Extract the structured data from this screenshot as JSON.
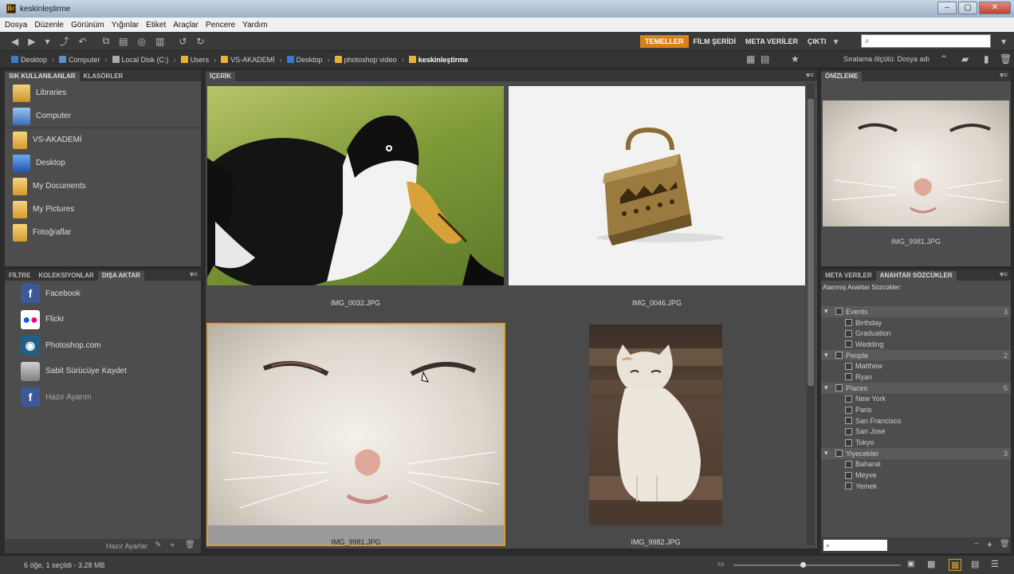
{
  "window": {
    "title": "keskinleştirme",
    "app_icon": "Br"
  },
  "menu": [
    "Dosya",
    "Düzenle",
    "Görünüm",
    "Yığınlar",
    "Etiket",
    "Araçlar",
    "Pencere",
    "Yardım"
  ],
  "workspaces": {
    "items": [
      "TEMELLER",
      "FİLM ŞERİDİ",
      "META VERİLER",
      "ÇIKTI"
    ],
    "active": 0,
    "accent": "#d8801a"
  },
  "search": {
    "placeholder": ""
  },
  "breadcrumb": [
    "Desktop",
    "Computer",
    "Local Disk (C:)",
    "Users",
    "VS-AKADEMİ",
    "Desktop",
    "photoshop video",
    "keskinleştirme"
  ],
  "sort_label": "Sıralama ölçütü: Dosya adı",
  "favorites": {
    "tabs": [
      "SIK KULLANILANLAR",
      "KLASÖRLER"
    ],
    "items": [
      {
        "label": "Libraries",
        "icon": "libraries-icon",
        "color": "#e6b84a"
      },
      {
        "label": "Computer",
        "icon": "computer-icon",
        "color": "#5a8fd0"
      },
      {
        "label": "VS-AKADEMİ",
        "icon": "folder-icon",
        "color": "#e8b23a"
      },
      {
        "label": "Desktop",
        "icon": "desktop-icon",
        "color": "#3a7ad0"
      },
      {
        "label": "My Documents",
        "icon": "folder-icon",
        "color": "#e8b23a"
      },
      {
        "label": "My Pictures",
        "icon": "folder-icon",
        "color": "#e8b23a"
      },
      {
        "label": "Fotoğraflar",
        "icon": "folder-icon",
        "color": "#e8b23a"
      }
    ]
  },
  "export": {
    "tabs": [
      "FİLTRE",
      "KOLEKSİYONLAR",
      "DIŞA AKTAR"
    ],
    "items": [
      {
        "label": "Facebook",
        "icon": "facebook-icon",
        "color": "#3b5998"
      },
      {
        "label": "Flickr",
        "icon": "flickr-icon",
        "color": "#ffffff"
      },
      {
        "label": "Photoshop.com",
        "icon": "photoshop-com-icon",
        "color": "#1f5f8a"
      },
      {
        "label": "Sabit Sürücüye Kaydet",
        "icon": "hard-drive-icon",
        "color": "#9a9a9a"
      },
      {
        "label": "Hazır Ayarım",
        "icon": "facebook-icon",
        "color": "#3b5998"
      }
    ],
    "footer": "Hazır Ayarlar"
  },
  "content": {
    "tab": "İÇERİK",
    "thumbs": [
      {
        "name": "IMG_0032.JPG",
        "subject": "duck"
      },
      {
        "name": "IMG_0046.JPG",
        "subject": "iron"
      },
      {
        "name": "IMG_9981.JPG",
        "subject": "cat-closeup"
      },
      {
        "name": "IMG_9982.JPG",
        "subject": "cat-sitting"
      }
    ]
  },
  "preview": {
    "tab": "ÖNİZLEME",
    "filename": "IMG_9981.JPG"
  },
  "keywords": {
    "tabs": [
      "META VERİLER",
      "ANAHTAR SÖZCÜKLER"
    ],
    "assigned_label": "Atanmış Anahtar Sözcükler:",
    "categories": [
      {
        "name": "Events",
        "count": "3",
        "items": [
          "Birthday",
          "Graduation",
          "Wedding"
        ]
      },
      {
        "name": "People",
        "count": "2",
        "items": [
          "Matthew",
          "Ryan"
        ]
      },
      {
        "name": "Places",
        "count": "5",
        "items": [
          "New York",
          "Paris",
          "San Francisco",
          "San Jose",
          "Tokyo"
        ]
      },
      {
        "name": "Yiyecekler",
        "count": "3",
        "items": [
          "Baharat",
          "Meyve",
          "Yemek"
        ]
      }
    ]
  },
  "status": {
    "text": "6 öğe, 1 seçildi - 3.28 MB",
    "zoom_fraction": 0.4
  }
}
